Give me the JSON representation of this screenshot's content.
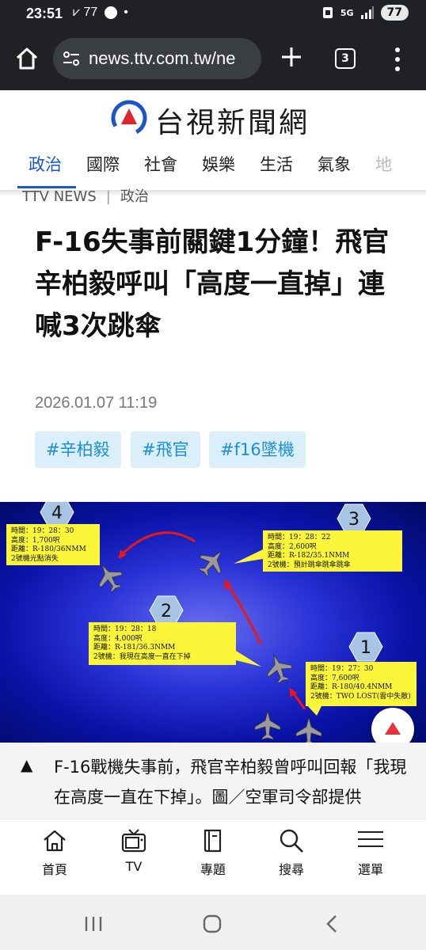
{
  "status_bar": {
    "time": "23:51",
    "notification_count": "77",
    "battery": "77",
    "network": "5G"
  },
  "browser": {
    "url": "news.ttv.com.tw/ne",
    "tab_count": "3"
  },
  "site": {
    "name": "台視新聞網"
  },
  "categories": [
    {
      "label": "政治",
      "active": true
    },
    {
      "label": "國際"
    },
    {
      "label": "社會"
    },
    {
      "label": "娛樂"
    },
    {
      "label": "生活"
    },
    {
      "label": "氣象"
    },
    {
      "label": "地"
    }
  ],
  "breadcrumb": {
    "source": "TTV NEWS",
    "section": "政治"
  },
  "article": {
    "headline": "F-16失事前關鍵1分鐘！飛官辛柏毅呼叫「高度一直掉」連喊3次跳傘",
    "date": "2026.01.07 11:19",
    "tags": [
      "#辛柏毅",
      "#飛官",
      "#f16墜機"
    ]
  },
  "figure": {
    "callouts": [
      {
        "num": "1",
        "lines": [
          "時間：19：27：30",
          "高度：7,600呎",
          "距離：R-180/40.4NMM",
          "2號機：TWO LOST(雲中失散)"
        ]
      },
      {
        "num": "2",
        "lines": [
          "時間：19：28：18",
          "高度：4,000呎",
          "距離：R-181/36.3NMM",
          "2號機：我現在高度一直在下掉"
        ]
      },
      {
        "num": "3",
        "lines": [
          "時間：19：28：22",
          "高度：2,600呎",
          "距離：R-182/35.1NMM",
          "2號機：預計跳傘跳傘跳傘"
        ]
      },
      {
        "num": "4",
        "lines": [
          "時間：19：28：30",
          "高度：1,700呎",
          "距離：R-180/36NMM",
          "2號機光點消失"
        ]
      }
    ],
    "caption_marker": "▲",
    "caption": "F-16戰機失事前，飛官辛柏毅曾呼叫回報「我現在高度一直在下掉」。圖／空軍司令部提供"
  },
  "bottom_nav": [
    {
      "label": "首頁",
      "icon": "home-icon"
    },
    {
      "label": "TV",
      "icon": "tv-icon"
    },
    {
      "label": "專題",
      "icon": "book-icon"
    },
    {
      "label": "搜尋",
      "icon": "search-icon"
    },
    {
      "label": "選單",
      "icon": "menu-icon"
    }
  ],
  "colors": {
    "accent": "#1a56c8",
    "tag_bg": "#dbeffa",
    "tag_text": "#1a8fd8",
    "callout": "#fbf63a",
    "scroll_top": "#e8323c"
  }
}
